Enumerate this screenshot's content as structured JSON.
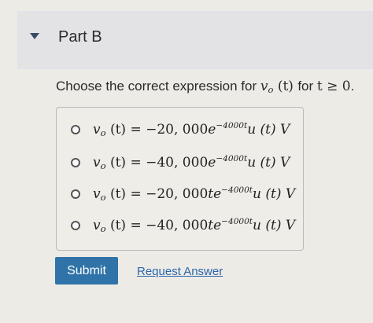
{
  "part": {
    "title": "Part B"
  },
  "question": {
    "prefix": "Choose the correct expression for ",
    "var_main": "v",
    "var_sub": "o",
    "var_arg": " (t) ",
    "middle": " for ",
    "cond": "t ≥ 0",
    "suffix": "."
  },
  "options": [
    {
      "lhs_main": "v",
      "lhs_sub": "o",
      "lhs_arg": " (t) = ",
      "coeff": "−20, 000",
      "base": "e",
      "exp": "−4000t",
      "tail": "u (t)  V"
    },
    {
      "lhs_main": "v",
      "lhs_sub": "o",
      "lhs_arg": " (t) = ",
      "coeff": "−40, 000",
      "base": "e",
      "exp": "−4000t",
      "tail": "u (t)  V"
    },
    {
      "lhs_main": "v",
      "lhs_sub": "o",
      "lhs_arg": " (t) = ",
      "coeff": "−20, 000",
      "base": "te",
      "exp": "−4000t",
      "tail": "u (t)  V"
    },
    {
      "lhs_main": "v",
      "lhs_sub": "o",
      "lhs_arg": " (t) = ",
      "coeff": "−40, 000",
      "base": "te",
      "exp": "−4000t",
      "tail": "u (t)  V"
    }
  ],
  "actions": {
    "submit_label": "Submit",
    "request_answer_label": "Request Answer"
  },
  "colors": {
    "submit_bg": "#2f73a8",
    "link": "#2b67ad",
    "header_bg": "#e3e3e6"
  },
  "icons": {
    "collapse": "caret-down-icon",
    "radio": "radio-button-icon"
  }
}
